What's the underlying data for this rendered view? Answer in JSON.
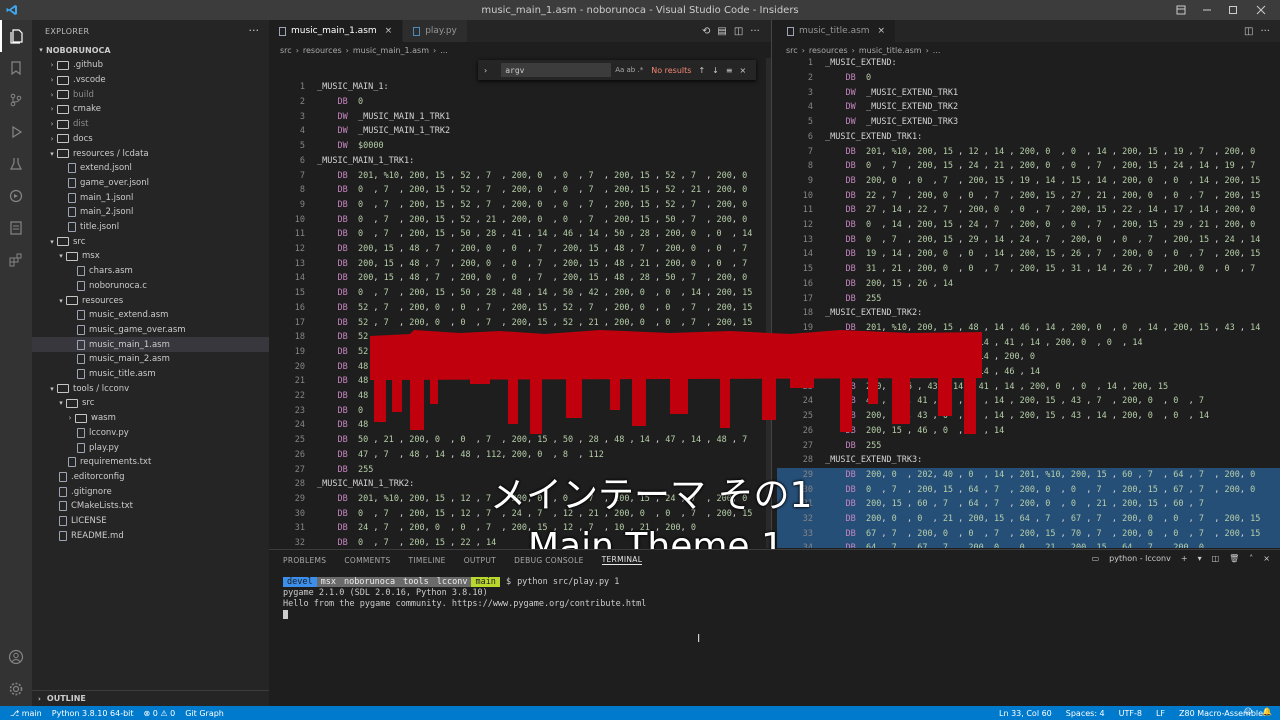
{
  "window": {
    "title": "music_main_1.asm - noborunoca - Visual Studio Code - Insiders"
  },
  "activity_bar": [
    "files-icon",
    "bookmark-icon",
    "source-control-icon",
    "run-debug-icon",
    "test-icon",
    "extensions-remote-icon",
    "notebook-icon",
    "extensions-icon",
    "account-icon",
    "settings-gear-icon"
  ],
  "sidebar": {
    "title": "EXPLORER",
    "project": "NOBORUNOCA",
    "outline": "OUTLINE",
    "items": [
      {
        "label": ".github",
        "depth": 1,
        "type": "folder",
        "open": false
      },
      {
        "label": ".vscode",
        "depth": 1,
        "type": "folder",
        "open": false
      },
      {
        "label": "build",
        "depth": 1,
        "type": "folder",
        "open": false,
        "dim": true
      },
      {
        "label": "cmake",
        "depth": 1,
        "type": "folder",
        "open": false
      },
      {
        "label": "dist",
        "depth": 1,
        "type": "folder",
        "open": false,
        "dim": true
      },
      {
        "label": "docs",
        "depth": 1,
        "type": "folder",
        "open": false
      },
      {
        "label": "resources / lcdata",
        "depth": 1,
        "type": "folder",
        "open": true
      },
      {
        "label": "extend.jsonl",
        "depth": 2,
        "type": "file"
      },
      {
        "label": "game_over.jsonl",
        "depth": 2,
        "type": "file"
      },
      {
        "label": "main_1.jsonl",
        "depth": 2,
        "type": "file"
      },
      {
        "label": "main_2.jsonl",
        "depth": 2,
        "type": "file"
      },
      {
        "label": "title.jsonl",
        "depth": 2,
        "type": "file"
      },
      {
        "label": "src",
        "depth": 1,
        "type": "folder",
        "open": true
      },
      {
        "label": "msx",
        "depth": 2,
        "type": "folder",
        "open": true
      },
      {
        "label": "chars.asm",
        "depth": 3,
        "type": "file"
      },
      {
        "label": "noborunoca.c",
        "depth": 3,
        "type": "file"
      },
      {
        "label": "resources",
        "depth": 2,
        "type": "folder",
        "open": true
      },
      {
        "label": "music_extend.asm",
        "depth": 3,
        "type": "file"
      },
      {
        "label": "music_game_over.asm",
        "depth": 3,
        "type": "file"
      },
      {
        "label": "music_main_1.asm",
        "depth": 3,
        "type": "file",
        "selected": true
      },
      {
        "label": "music_main_2.asm",
        "depth": 3,
        "type": "file"
      },
      {
        "label": "music_title.asm",
        "depth": 3,
        "type": "file"
      },
      {
        "label": "tools / lcconv",
        "depth": 1,
        "type": "folder",
        "open": true
      },
      {
        "label": "src",
        "depth": 2,
        "type": "folder",
        "open": true
      },
      {
        "label": "wasm",
        "depth": 3,
        "type": "folder",
        "open": false
      },
      {
        "label": "lcconv.py",
        "depth": 3,
        "type": "file"
      },
      {
        "label": "play.py",
        "depth": 3,
        "type": "file"
      },
      {
        "label": "requirements.txt",
        "depth": 2,
        "type": "file"
      },
      {
        "label": ".editorconfig",
        "depth": 1,
        "type": "file"
      },
      {
        "label": ".gitignore",
        "depth": 1,
        "type": "file"
      },
      {
        "label": "CMakeLists.txt",
        "depth": 1,
        "type": "file"
      },
      {
        "label": "LICENSE",
        "depth": 1,
        "type": "file"
      },
      {
        "label": "README.md",
        "depth": 1,
        "type": "file"
      }
    ]
  },
  "editor_left": {
    "tabs": [
      {
        "label": "music_main_1.asm",
        "active": true
      },
      {
        "label": "play.py",
        "active": false
      }
    ],
    "breadcrumb": [
      "src",
      "resources",
      "music_main_1.asm",
      "..."
    ],
    "find": {
      "query": "argv",
      "options": "Aa ab .*",
      "result": "No results"
    },
    "lines": [
      {
        "n": 1,
        "t": "_MUSIC_MAIN_1:"
      },
      {
        "n": 2,
        "t": "    DB  0"
      },
      {
        "n": 3,
        "t": "    DW  _MUSIC_MAIN_1_TRK1"
      },
      {
        "n": 4,
        "t": "    DW  _MUSIC_MAIN_1_TRK2"
      },
      {
        "n": 5,
        "t": "    DW  $0000"
      },
      {
        "n": 6,
        "t": "_MUSIC_MAIN_1_TRK1:"
      },
      {
        "n": 7,
        "t": "    DB  201, %10, 200, 15 , 52 , 7  , 200, 0  , 0  , 7  , 200, 15 , 52 , 7  , 200, 0"
      },
      {
        "n": 8,
        "t": "    DB  0  , 7  , 200, 15 , 52 , 7  , 200, 0  , 0  , 7  , 200, 15 , 52 , 21 , 200, 0"
      },
      {
        "n": 9,
        "t": "    DB  0  , 7  , 200, 15 , 52 , 7  , 200, 0  , 0  , 7  , 200, 15 , 52 , 7  , 200, 0"
      },
      {
        "n": 10,
        "t": "    DB  0  , 7  , 200, 15 , 52 , 21 , 200, 0  , 0  , 7  , 200, 15 , 50 , 7  , 200, 0"
      },
      {
        "n": 11,
        "t": "    DB  0  , 7  , 200, 15 , 50 , 28 , 41 , 14 , 46 , 14 , 50 , 28 , 200, 0  , 0  , 14"
      },
      {
        "n": 12,
        "t": "    DB  200, 15 , 48 , 7  , 200, 0  , 0  , 7  , 200, 15 , 48 , 7  , 200, 0  , 0  , 7"
      },
      {
        "n": 13,
        "t": "    DB  200, 15 , 48 , 7  , 200, 0  , 0  , 7  , 200, 15 , 48 , 21 , 200, 0  , 0  , 7"
      },
      {
        "n": 14,
        "t": "    DB  200, 15 , 48 , 7  , 200, 0  , 0  , 7  , 200, 15 , 48 , 28 , 50 , 7  , 200, 0"
      },
      {
        "n": 15,
        "t": "    DB  0  , 7  , 200, 15 , 50 , 28 , 48 , 14 , 50 , 42 , 200, 0  , 0  , 14 , 200, 15"
      },
      {
        "n": 16,
        "t": "    DB  52 , 7  , 200, 0  , 0  , 7  , 200, 15 , 52 , 7  , 200, 0  , 0  , 7  , 200, 15"
      },
      {
        "n": 17,
        "t": "    DB  52 , 7  , 200, 0  , 0  , 7  , 200, 15 , 52 , 21 , 200, 0  , 0  , 7  , 200, 15"
      },
      {
        "n": 18,
        "t": "    DB  52"
      },
      {
        "n": 19,
        "t": "    DB  52"
      },
      {
        "n": 20,
        "t": "    DB  48"
      },
      {
        "n": 21,
        "t": "    DB  48"
      },
      {
        "n": 22,
        "t": "    DB  48"
      },
      {
        "n": 23,
        "t": "    DB  0"
      },
      {
        "n": 24,
        "t": "    DB  48"
      },
      {
        "n": 25,
        "t": "    DB  50 , 21 , 200, 0  , 0  , 7  , 200, 15 , 50 , 28 , 48 , 14 , 47 , 14 , 48 , 7"
      },
      {
        "n": 26,
        "t": "    DB  47 , 7  , 48 , 14 , 48 , 112, 200, 0  , 8  , 112"
      },
      {
        "n": 27,
        "t": "    DB  255"
      },
      {
        "n": 28,
        "t": "_MUSIC_MAIN_1_TRK2:"
      },
      {
        "n": 29,
        "t": "    DB  201, %10, 200, 15 , 12 , 7  , 200, 0  , 0  , 7  , 200, 15 , 24 , 7  , 200, 0"
      },
      {
        "n": 30,
        "t": "    DB  0  , 7  , 200, 15 , 12 , 7  , 24 , 7  , 12 , 21 , 200, 0  , 0  , 7  , 200, 15"
      },
      {
        "n": 31,
        "t": "    DB  24 , 7  , 200, 0  , 0  , 7  , 200, 15 , 12 , 7  , 10 , 21 , 200, 0"
      },
      {
        "n": 32,
        "t": "    DB  0  , 7  , 200, 15 , 22 , 14"
      }
    ]
  },
  "editor_right": {
    "tab": "music_title.asm",
    "breadcrumb": [
      "src",
      "resources",
      "music_title.asm",
      "..."
    ],
    "lines": [
      {
        "n": 1,
        "t": "_MUSIC_EXTEND:"
      },
      {
        "n": 2,
        "t": "    DB  0"
      },
      {
        "n": 3,
        "t": "    DW  _MUSIC_EXTEND_TRK1"
      },
      {
        "n": 4,
        "t": "    DW  _MUSIC_EXTEND_TRK2"
      },
      {
        "n": 5,
        "t": "    DW  _MUSIC_EXTEND_TRK3"
      },
      {
        "n": 6,
        "t": "_MUSIC_EXTEND_TRK1:"
      },
      {
        "n": 7,
        "t": "    DB  201, %10, 200, 15 , 12 , 14 , 200, 0  , 0  , 14 , 200, 15 , 19 , 7  , 200, 0"
      },
      {
        "n": 8,
        "t": "    DB  0  , 7  , 200, 15 , 24 , 21 , 200, 0  , 0  , 7  , 200, 15 , 24 , 14 , 19 , 7"
      },
      {
        "n": 9,
        "t": "    DB  200, 0  , 0  , 7  , 200, 15 , 19 , 14 , 15 , 14 , 200, 0  , 0  , 14 , 200, 15"
      },
      {
        "n": 10,
        "t": "    DB  22 , 7  , 200, 0  , 0  , 7  , 200, 15 , 27 , 21 , 200, 0  , 0  , 7  , 200, 15"
      },
      {
        "n": 11,
        "t": "    DB  27 , 14 , 22 , 7  , 200, 0  , 0  , 7  , 200, 15 , 22 , 14 , 17 , 14 , 200, 0"
      },
      {
        "n": 12,
        "t": "    DB  0  , 14 , 200, 15 , 24 , 7  , 200, 0  , 0  , 7  , 200, 15 , 29 , 21 , 200, 0"
      },
      {
        "n": 13,
        "t": "    DB  0  , 7  , 200, 15 , 29 , 14 , 24 , 7  , 200, 0  , 0  , 7  , 200, 15 , 24 , 14"
      },
      {
        "n": 14,
        "t": "    DB  19 , 14 , 200, 0  , 0  , 14 , 200, 15 , 26 , 7  , 200, 0  , 0  , 7  , 200, 15"
      },
      {
        "n": 15,
        "t": "    DB  31 , 21 , 200, 0  , 0  , 7  , 200, 15 , 31 , 14 , 26 , 7  , 200, 0  , 0  , 7"
      },
      {
        "n": 16,
        "t": "    DB  200, 15 , 26 , 14"
      },
      {
        "n": 17,
        "t": "    DB  255"
      },
      {
        "n": 18,
        "t": "_MUSIC_EXTEND_TRK2:"
      },
      {
        "n": 19,
        "t": "    DB  201, %10, 200, 15 , 48 , 14 , 46 , 14 , 200, 0  , 0  , 14 , 200, 15 , 43 , 14"
      },
      {
        "n": 20,
        "t": "    DB  , 14 , 200, 15 , 43 , 14 , 41 , 14 , 200, 0  , 0  , 14"
      },
      {
        "n": 21,
        "t": "    DB  , 14 , 200, 15 , 39 , 14 , 200, 0"
      },
      {
        "n": 22,
        "t": "    DB  , 14 , 200, 15 , 48 , 14 , 46 , 14"
      },
      {
        "n": 23,
        "t": "    DB  200, , 15 , 43 , 14 , 41 , 14 , 200, 0  , 0  , 14 , 200, 15"
      },
      {
        "n": 24,
        "t": "    DB  43 , 14 , 41 , 0  , 0  , 14 , 200, 15 , 43 , 7  , 200, 0  , 0  , 7"
      },
      {
        "n": 25,
        "t": "    DB  200, 15 , 43 , 0  , 0  , 14 , 200, 15 , 43 , 14 , 200, 0  , 0  , 14"
      },
      {
        "n": 26,
        "t": "    DB  200, 15 , 46 , 0  , 0  , 14"
      },
      {
        "n": 27,
        "t": "    DB  255"
      },
      {
        "n": 28,
        "t": "_MUSIC_EXTEND_TRK3:"
      },
      {
        "n": 29,
        "t": "    DB  200, 0  , 202, 40 , 0  , 14 , 201, %10, 200, 15 , 60 , 7  , 64 , 7  , 200, 0"
      },
      {
        "n": 30,
        "t": "    DB  0  , 7  , 200, 15 , 64 , 7  , 200, 0  , 0  , 7  , 200, 15 , 67 , 7  , 200, 0"
      },
      {
        "n": 31,
        "t": "    DB  200, 15 , 60 , 7  , 64 , 7  , 200, 0  , 0  , 21 , 200, 15 , 60 , 7"
      },
      {
        "n": 32,
        "t": "    DB  200, 0  , 0  , 21 , 200, 15 , 64 , 7  , 67 , 7  , 200, 0  , 0  , 7  , 200, 15"
      },
      {
        "n": 33,
        "t": "    DB  67 , 7  , 200, 0  , 0  , 7  , 200, 15 , 70 , 7  , 200, 0  , 0  , 7  , 200, 15"
      },
      {
        "n": 34,
        "t": "    DB  64 , 7  , 67 , 7  , 200, 0  , 0  , 21 , 200, 15 , 64 , 7  , 200, 0"
      }
    ]
  },
  "panel": {
    "tabs": [
      "PROBLEMS",
      "COMMENTS",
      "TIMELINE",
      "OUTPUT",
      "DEBUG CONSOLE",
      "TERMINAL"
    ],
    "active_tab": "TERMINAL",
    "terminal_name": "python - lcconv",
    "prompt_segments": [
      "devel",
      "msx",
      "noborunoca",
      "tools",
      "lcconv",
      "main",
      "$"
    ],
    "command": "python src/play.py 1",
    "output": [
      "pygame 2.1.0 (SDL 2.0.16, Python 3.8.10)",
      "Hello from the pygame community. https://www.pygame.org/contribute.html"
    ]
  },
  "statusbar": {
    "branch": "main",
    "python": "Python 3.8.10 64-bit",
    "errors": "0",
    "warnings": "0",
    "git_graph": "Git Graph",
    "position": "Ln 33, Col 60",
    "spaces": "Spaces: 4",
    "encoding": "UTF-8",
    "eol": "LF",
    "language": "Z80 Macro-Assembler"
  },
  "captions": {
    "japanese": "メインテーマ その1",
    "english": "Main Theme 1"
  },
  "colors": {
    "accent": "#007acc",
    "overlay_red": "#c0000d",
    "caption_text": "#ffffff"
  }
}
